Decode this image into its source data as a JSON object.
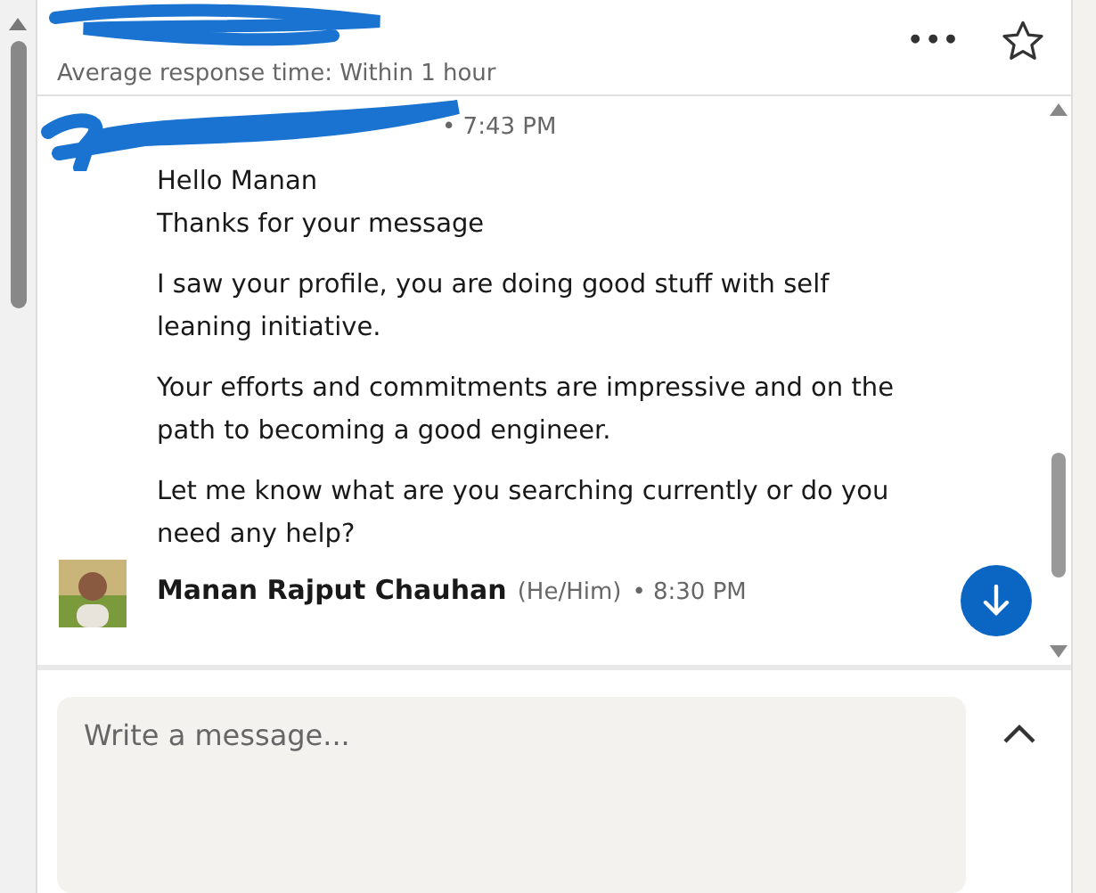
{
  "header": {
    "subtitle": "Average response time: Within 1 hour",
    "more_icon": "•••"
  },
  "messages": [
    {
      "kind": "redacted",
      "time": "• 7:43 PM",
      "paragraphs": [
        "Hello Manan\nThanks for your message",
        "I saw your profile, you are doing good stuff with self leaning initiative.",
        "Your efforts and commitments are impressive and on the path to becoming a good engineer.",
        "Let me know what are you searching currently or do you need any help?"
      ]
    },
    {
      "kind": "named",
      "sender": "Manan Rajput Chauhan",
      "pronouns": "(He/Him)",
      "time": "• 8:30 PM"
    }
  ],
  "composer": {
    "placeholder": "Write a message..."
  }
}
